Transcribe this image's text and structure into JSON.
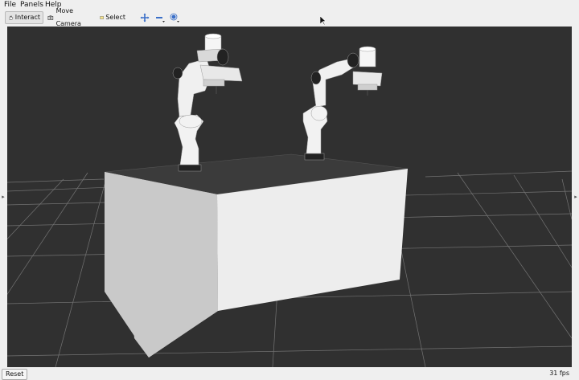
{
  "menu": [
    "File",
    "Panels",
    "Help"
  ],
  "toolbar": {
    "interact": "Interact",
    "move_camera": "Move Camera",
    "select": "Select"
  },
  "status": {
    "reset": "Reset",
    "fps": "31 fps"
  },
  "colors": {
    "viewport_bg": "#303030",
    "grid": "#8a8a8a",
    "table_top": "#3c3c3c",
    "table_front": "#e8e8e8",
    "table_side": "#bdbdbd",
    "robot_white": "#f2f2f2",
    "robot_dark": "#222222"
  }
}
